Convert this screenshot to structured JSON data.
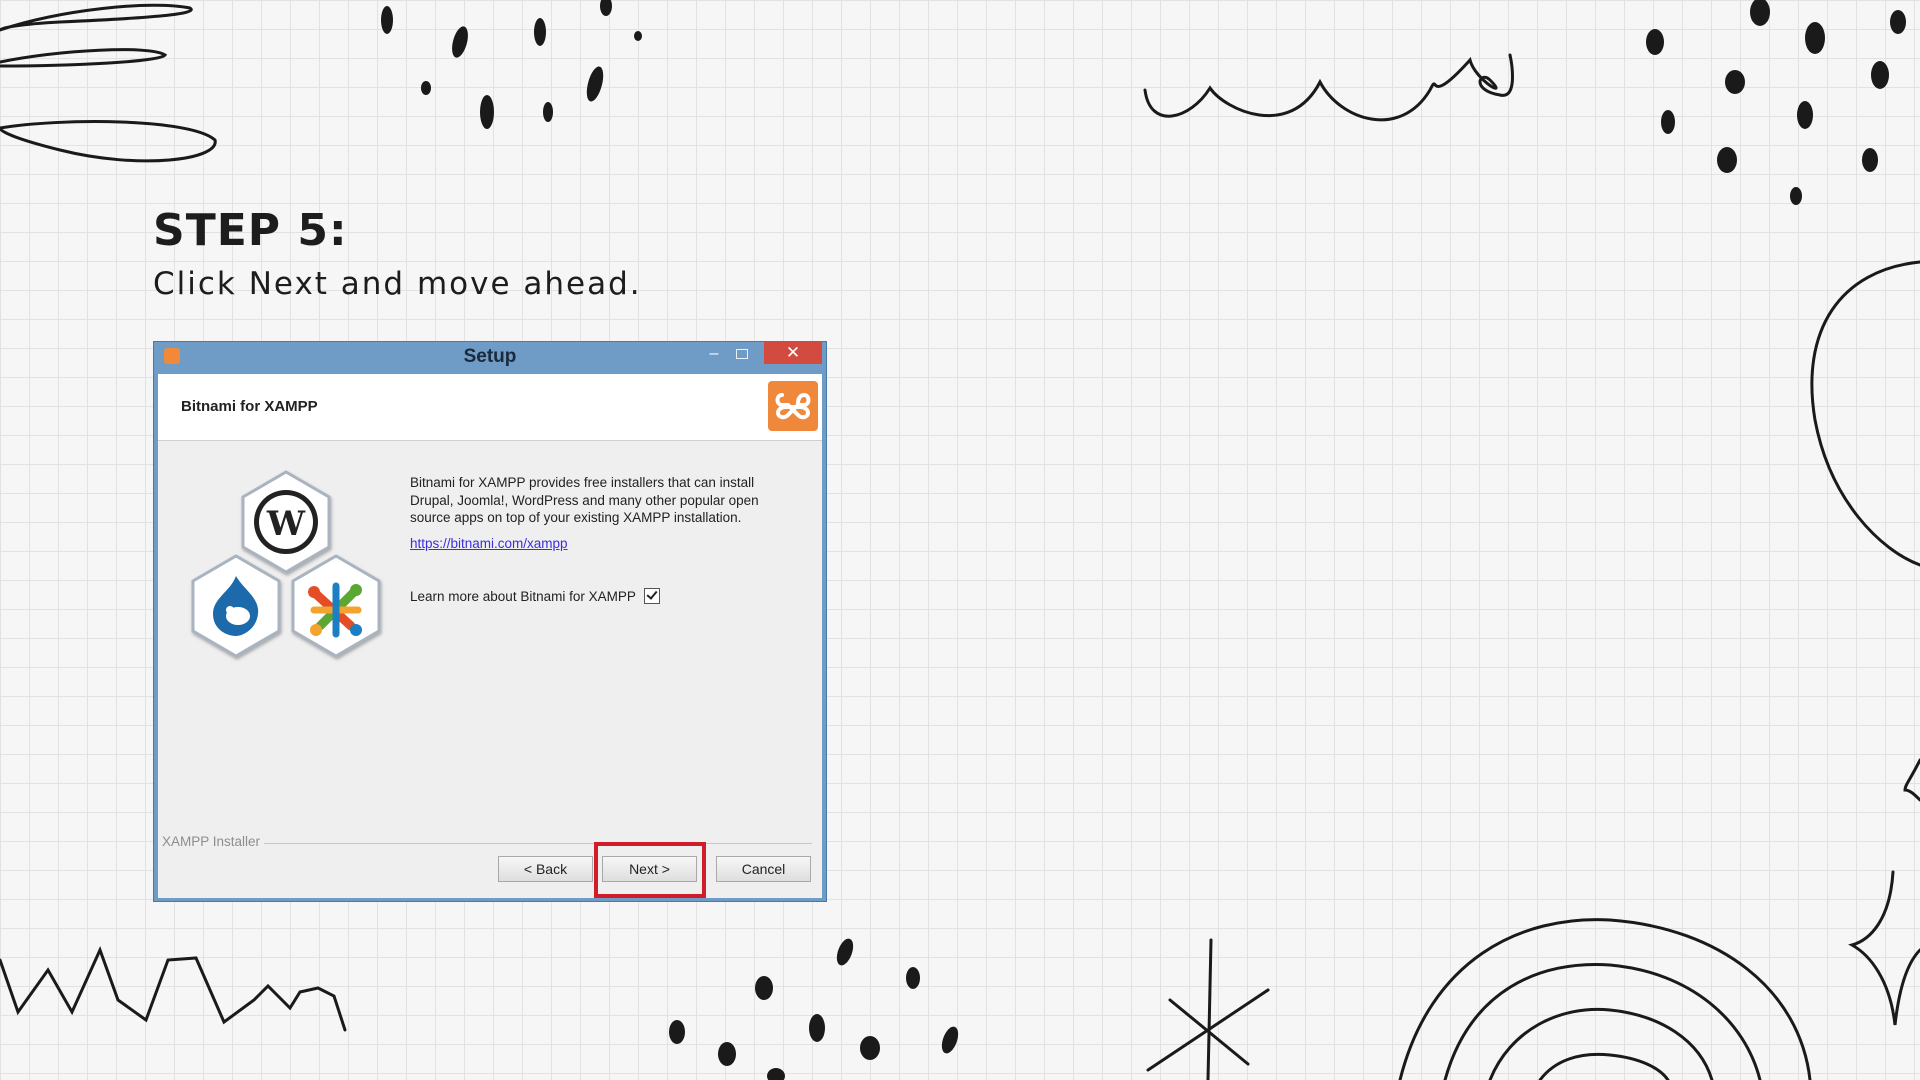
{
  "slide": {
    "step_title": "STEP 5:",
    "step_subtitle": "Click Next and move ahead."
  },
  "dialog": {
    "title": "Setup",
    "controls": {
      "minimize": "–",
      "close": "✕"
    },
    "header_title": "Bitnami for XAMPP",
    "description": "Bitnami for XAMPP provides free installers that can install Drupal, Joomla!, WordPress and many other popular open source apps on top of your existing XAMPP installation.",
    "link": "https://bitnami.com/xampp",
    "learn_more_label": "Learn more about Bitnami for XAMPP",
    "learn_more_checked": true,
    "installer_label": "XAMPP Installer",
    "buttons": {
      "back": "< Back",
      "next": "Next >",
      "cancel": "Cancel"
    }
  },
  "colors": {
    "highlight": "#d01d2a",
    "titlebar": "#6f9bc7",
    "close": "#d24a40",
    "xampp_orange": "#f0883c"
  }
}
